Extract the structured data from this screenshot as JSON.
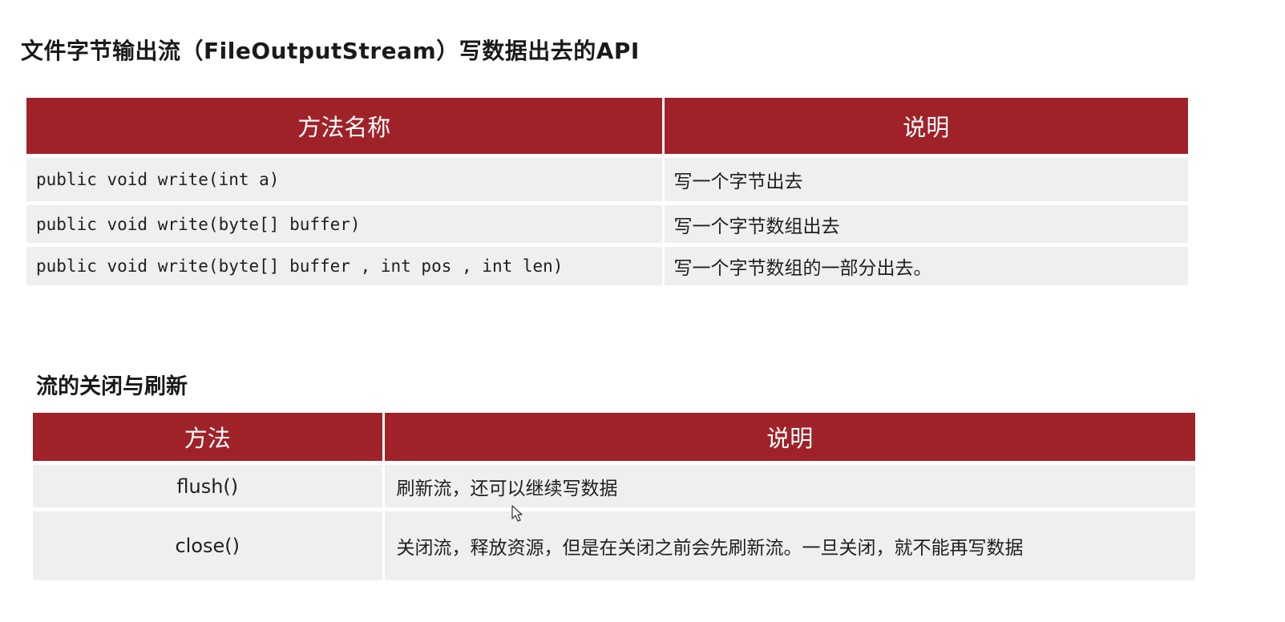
{
  "colors": {
    "header_bg": "#a02229",
    "row_bg": "#efefef",
    "header_text": "#ffffff"
  },
  "title": "文件字节输出流（FileOutputStream）写数据出去的API",
  "api_table": {
    "headers": [
      "方法名称",
      "说明"
    ],
    "rows": [
      {
        "method": "public void write(int a)",
        "desc": "写一个字节出去"
      },
      {
        "method": "public void write(byte[] buffer)",
        "desc": "写一个字节数组出去"
      },
      {
        "method": "public void write(byte[] buffer , int pos , int len)",
        "desc": "写一个字节数组的一部分出去。"
      }
    ]
  },
  "section2_title": "流的关闭与刷新",
  "flush_table": {
    "headers": [
      "方法",
      "说明"
    ],
    "rows": [
      {
        "method": "flush()",
        "desc": "刷新流，还可以继续写数据"
      },
      {
        "method": "close()",
        "desc": "关闭流，释放资源，但是在关闭之前会先刷新流。一旦关闭，就不能再写数据"
      }
    ]
  },
  "icons": {
    "cursor": "mouse-pointer-icon"
  }
}
